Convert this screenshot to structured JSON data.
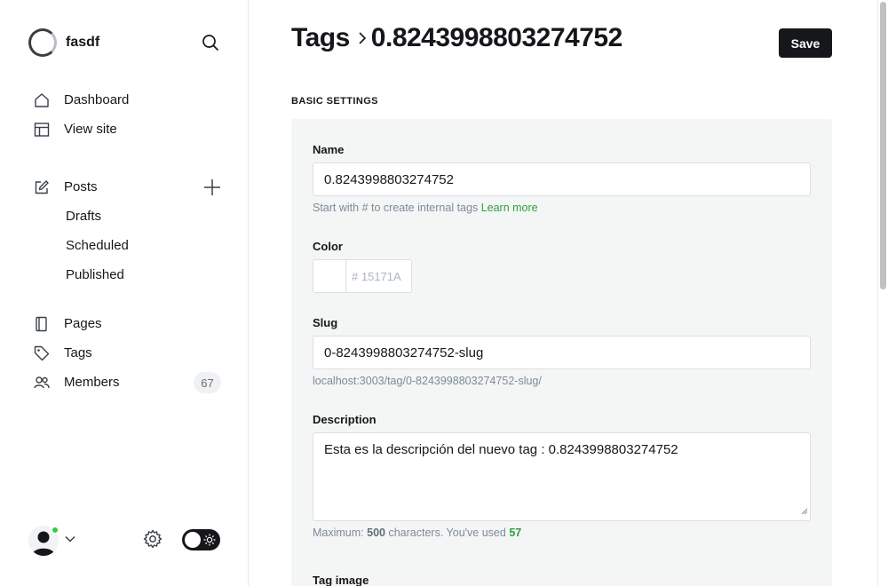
{
  "brand": {
    "name": "fasdf"
  },
  "sidebar": {
    "primary": [
      {
        "label": "Dashboard",
        "icon": "home-icon"
      },
      {
        "label": "View site",
        "icon": "layout-icon"
      }
    ],
    "posts": {
      "label": "Posts",
      "icon": "edit-icon",
      "add_icon": "plus-icon"
    },
    "post_sub": [
      "Drafts",
      "Scheduled",
      "Published"
    ],
    "secondary": [
      {
        "label": "Pages",
        "icon": "page-icon"
      },
      {
        "label": "Tags",
        "icon": "tag-icon"
      },
      {
        "label": "Members",
        "icon": "members-icon",
        "count": "67"
      }
    ]
  },
  "header": {
    "breadcrumb_root": "Tags",
    "breadcrumb_current": "0.8243998803274752",
    "save_label": "Save"
  },
  "form": {
    "section_title": "BASIC SETTINGS",
    "name": {
      "label": "Name",
      "value": "0.8243998803274752",
      "hint": "Start with # to create internal tags",
      "hint_link": "Learn more"
    },
    "color": {
      "label": "Color",
      "prefix": "#",
      "placeholder": "15171A"
    },
    "slug": {
      "label": "Slug",
      "value": "0-8243998803274752-slug",
      "url": "localhost:3003/tag/0-8243998803274752-slug/"
    },
    "description": {
      "label": "Description",
      "value": "Esta es la descripción del nuevo tag : 0.8243998803274752",
      "hint_prefix": "Maximum:",
      "max": "500",
      "hint_middle": "characters. You've used",
      "used": "57"
    },
    "tag_image": {
      "label": "Tag image"
    }
  },
  "colors": {
    "accent": "#30CF43",
    "dark": "#15171A"
  }
}
